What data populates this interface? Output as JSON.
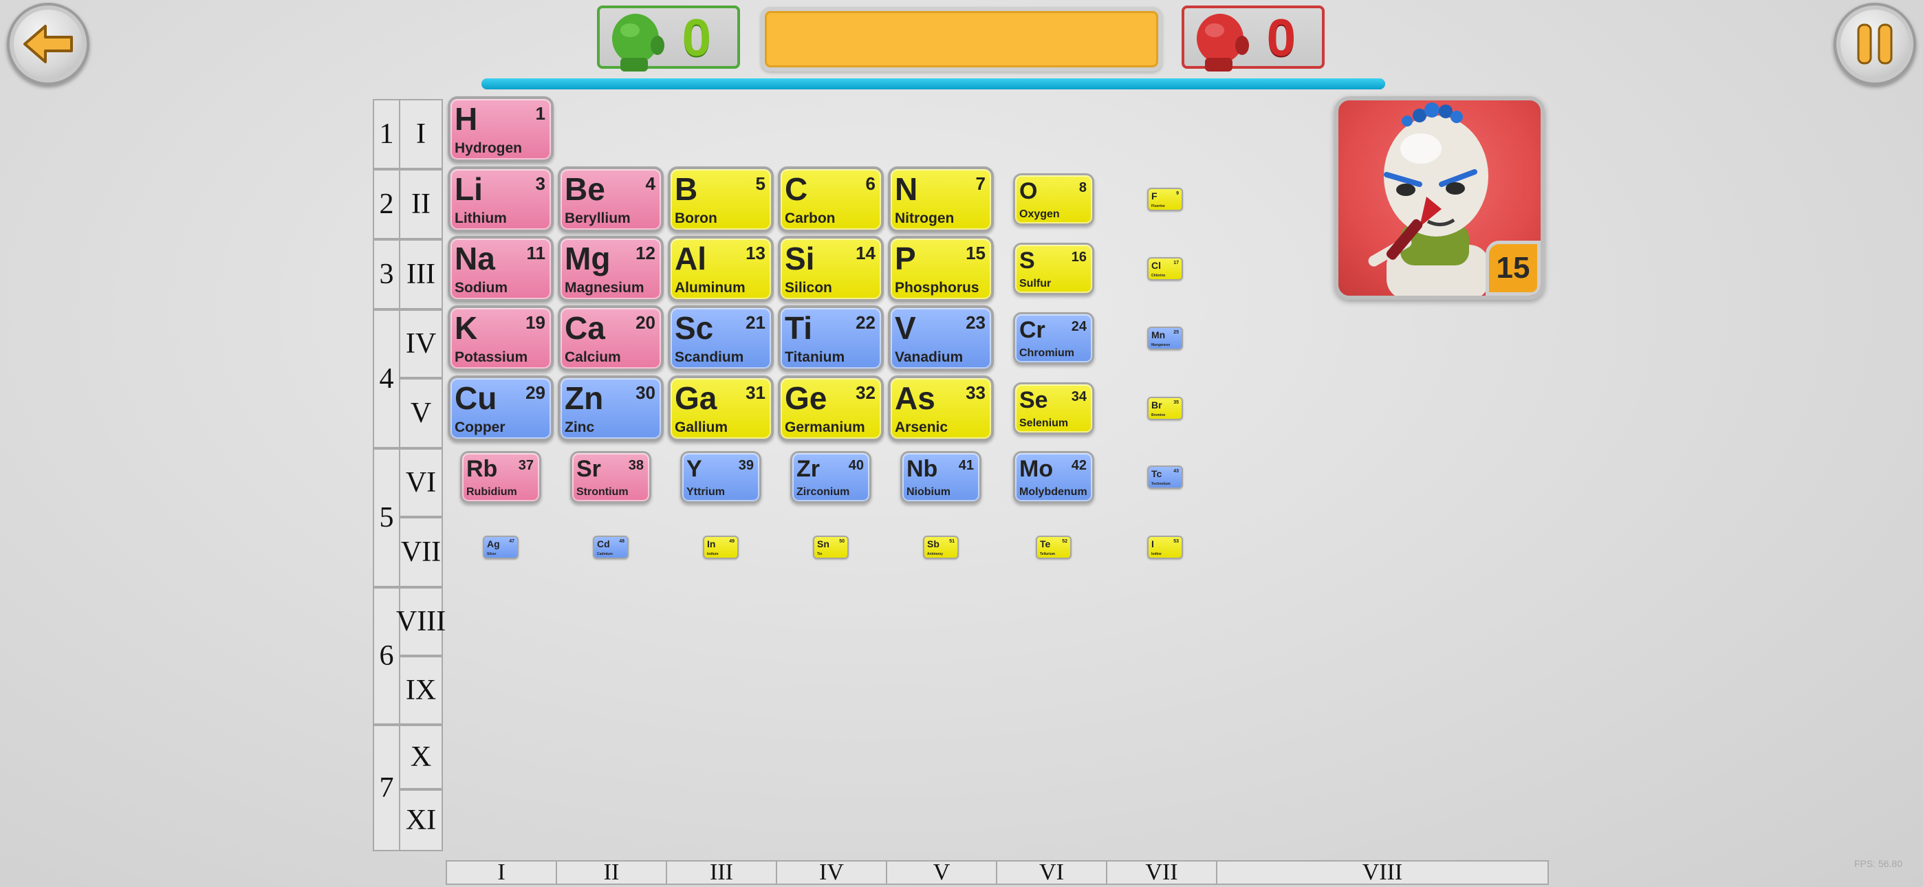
{
  "hud": {
    "player_score": "0",
    "opponent_score": "0",
    "question_text": "",
    "timer_fraction": 1.0,
    "opponent_level": "15",
    "fps": "FPS: 56.80"
  },
  "periods": [
    "1",
    "2",
    "3",
    "4",
    "5",
    "6",
    "7"
  ],
  "rows": [
    "I",
    "II",
    "III",
    "IV",
    "V",
    "VI",
    "VII",
    "VIII",
    "IX",
    "X",
    "XI"
  ],
  "groups": [
    "I",
    "II",
    "III",
    "IV",
    "V",
    "VI",
    "VII",
    "VIII"
  ],
  "elements": [
    {
      "symbol": "H",
      "number": "1",
      "name": "Hydrogen",
      "color": "pink",
      "size": "L",
      "col": 0,
      "row": 0
    },
    {
      "symbol": "Li",
      "number": "3",
      "name": "Lithium",
      "color": "pink",
      "size": "L",
      "col": 0,
      "row": 1
    },
    {
      "symbol": "Be",
      "number": "4",
      "name": "Beryllium",
      "color": "pink",
      "size": "L",
      "col": 1,
      "row": 1
    },
    {
      "symbol": "B",
      "number": "5",
      "name": "Boron",
      "color": "yellow",
      "size": "L",
      "col": 2,
      "row": 1
    },
    {
      "symbol": "C",
      "number": "6",
      "name": "Carbon",
      "color": "yellow",
      "size": "L",
      "col": 3,
      "row": 1
    },
    {
      "symbol": "N",
      "number": "7",
      "name": "Nitrogen",
      "color": "yellow",
      "size": "L",
      "col": 4,
      "row": 1
    },
    {
      "symbol": "O",
      "number": "8",
      "name": "Oxygen",
      "color": "yellow",
      "size": "M",
      "col": 5,
      "row": 1
    },
    {
      "symbol": "F",
      "number": "9",
      "name": "Fluorine",
      "color": "yellow",
      "size": "S",
      "col": 6,
      "row": 1
    },
    {
      "symbol": "Na",
      "number": "11",
      "name": "Sodium",
      "color": "pink",
      "size": "L",
      "col": 0,
      "row": 2
    },
    {
      "symbol": "Mg",
      "number": "12",
      "name": "Magnesium",
      "color": "pink",
      "size": "L",
      "col": 1,
      "row": 2
    },
    {
      "symbol": "Al",
      "number": "13",
      "name": "Aluminum",
      "color": "yellow",
      "size": "L",
      "col": 2,
      "row": 2
    },
    {
      "symbol": "Si",
      "number": "14",
      "name": "Silicon",
      "color": "yellow",
      "size": "L",
      "col": 3,
      "row": 2
    },
    {
      "symbol": "P",
      "number": "15",
      "name": "Phosphorus",
      "color": "yellow",
      "size": "L",
      "col": 4,
      "row": 2
    },
    {
      "symbol": "S",
      "number": "16",
      "name": "Sulfur",
      "color": "yellow",
      "size": "M",
      "col": 5,
      "row": 2
    },
    {
      "symbol": "Cl",
      "number": "17",
      "name": "Chlorine",
      "color": "yellow",
      "size": "S",
      "col": 6,
      "row": 2
    },
    {
      "symbol": "K",
      "number": "19",
      "name": "Potassium",
      "color": "pink",
      "size": "L",
      "col": 0,
      "row": 3
    },
    {
      "symbol": "Ca",
      "number": "20",
      "name": "Calcium",
      "color": "pink",
      "size": "L",
      "col": 1,
      "row": 3
    },
    {
      "symbol": "Sc",
      "number": "21",
      "name": "Scandium",
      "color": "blue",
      "size": "L",
      "col": 2,
      "row": 3
    },
    {
      "symbol": "Ti",
      "number": "22",
      "name": "Titanium",
      "color": "blue",
      "size": "L",
      "col": 3,
      "row": 3
    },
    {
      "symbol": "V",
      "number": "23",
      "name": "Vanadium",
      "color": "blue",
      "size": "L",
      "col": 4,
      "row": 3
    },
    {
      "symbol": "Cr",
      "number": "24",
      "name": "Chromium",
      "color": "blue",
      "size": "M",
      "col": 5,
      "row": 3
    },
    {
      "symbol": "Mn",
      "number": "25",
      "name": "Manganese",
      "color": "blue",
      "size": "S",
      "col": 6,
      "row": 3
    },
    {
      "symbol": "Cu",
      "number": "29",
      "name": "Copper",
      "color": "blue",
      "size": "L",
      "col": 0,
      "row": 4
    },
    {
      "symbol": "Zn",
      "number": "30",
      "name": "Zinc",
      "color": "blue",
      "size": "L",
      "col": 1,
      "row": 4
    },
    {
      "symbol": "Ga",
      "number": "31",
      "name": "Gallium",
      "color": "yellow",
      "size": "L",
      "col": 2,
      "row": 4
    },
    {
      "symbol": "Ge",
      "number": "32",
      "name": "Germanium",
      "color": "yellow",
      "size": "L",
      "col": 3,
      "row": 4
    },
    {
      "symbol": "As",
      "number": "33",
      "name": "Arsenic",
      "color": "yellow",
      "size": "L",
      "col": 4,
      "row": 4
    },
    {
      "symbol": "Se",
      "number": "34",
      "name": "Selenium",
      "color": "yellow",
      "size": "M",
      "col": 5,
      "row": 4
    },
    {
      "symbol": "Br",
      "number": "35",
      "name": "Bromine",
      "color": "yellow",
      "size": "S",
      "col": 6,
      "row": 4
    },
    {
      "symbol": "Rb",
      "number": "37",
      "name": "Rubidium",
      "color": "pink",
      "size": "M",
      "col": 0,
      "row": 5
    },
    {
      "symbol": "Sr",
      "number": "38",
      "name": "Strontium",
      "color": "pink",
      "size": "M",
      "col": 1,
      "row": 5
    },
    {
      "symbol": "Y",
      "number": "39",
      "name": "Yttrium",
      "color": "blue",
      "size": "M",
      "col": 2,
      "row": 5
    },
    {
      "symbol": "Zr",
      "number": "40",
      "name": "Zirconium",
      "color": "blue",
      "size": "M",
      "col": 3,
      "row": 5
    },
    {
      "symbol": "Nb",
      "number": "41",
      "name": "Niobium",
      "color": "blue",
      "size": "M",
      "col": 4,
      "row": 5
    },
    {
      "symbol": "Mo",
      "number": "42",
      "name": "Molybdenum",
      "color": "blue",
      "size": "M",
      "col": 5,
      "row": 5
    },
    {
      "symbol": "Tc",
      "number": "43",
      "name": "Technetium",
      "color": "blue",
      "size": "S",
      "col": 6,
      "row": 5
    },
    {
      "symbol": "Ag",
      "number": "47",
      "name": "Silver",
      "color": "blue",
      "size": "S",
      "col": 0,
      "row": 6
    },
    {
      "symbol": "Cd",
      "number": "48",
      "name": "Cadmium",
      "color": "blue",
      "size": "S",
      "col": 1,
      "row": 6
    },
    {
      "symbol": "In",
      "number": "49",
      "name": "Indium",
      "color": "yellow",
      "size": "S",
      "col": 2,
      "row": 6
    },
    {
      "symbol": "Sn",
      "number": "50",
      "name": "Tin",
      "color": "yellow",
      "size": "S",
      "col": 3,
      "row": 6
    },
    {
      "symbol": "Sb",
      "number": "51",
      "name": "Antimony",
      "color": "yellow",
      "size": "S",
      "col": 4,
      "row": 6
    },
    {
      "symbol": "Te",
      "number": "52",
      "name": "Tellurium",
      "color": "yellow",
      "size": "S",
      "col": 5,
      "row": 6
    },
    {
      "symbol": "I",
      "number": "53",
      "name": "Iodine",
      "color": "yellow",
      "size": "S",
      "col": 6,
      "row": 6
    }
  ],
  "icons": {
    "back": "back-arrow-icon",
    "pause": "pause-icon",
    "player": "green-head-icon",
    "opponent": "red-head-icon"
  },
  "colors": {
    "alkali_pink": "#e97aa2",
    "metalloid_yellow": "#e8e000",
    "transition_blue": "#6c98ee",
    "question_bar": "#fbbb3a",
    "timer": "#0a9fcb",
    "player_green": "#7dc41f",
    "opponent_red": "#d22a2a",
    "level_badge": "#f2a51c"
  }
}
